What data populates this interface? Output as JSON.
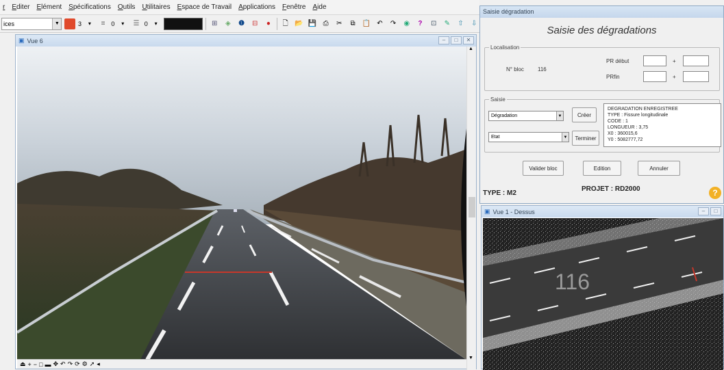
{
  "menu": {
    "items": [
      "r",
      "Editer",
      "Elément",
      "Spécifications",
      "Outils",
      "Utilitaires",
      "Espace de Travail",
      "Applications",
      "Fenêtre",
      "Aide"
    ]
  },
  "toolbar": {
    "combo_value": "ices",
    "spin1": "3",
    "spin2": "0",
    "spin3": "0"
  },
  "vue6": {
    "title": "Vue 6"
  },
  "dialog": {
    "window_title": "Saisie dégradation",
    "heading": "Saisie des dégradations",
    "localisation": {
      "legend": "Localisation",
      "bloc_label": "N° bloc",
      "bloc_value": "116",
      "pr_debut_label": "PR début",
      "pr_fin_label": "PRfin",
      "plus": "+"
    },
    "saisie": {
      "legend": "Saisie",
      "select1": "Dégradation",
      "select2": "Etat",
      "creer_button": "Créer",
      "terminer_button": "Terminer",
      "info_lines": [
        "DEGRADATION ENREGISTREE",
        "TYPE : Fissure longitudinale",
        "CODE : 1",
        "LONGUEUR : 3,75",
        "X0 : 360015,6",
        "Y0 : 5082777,72"
      ]
    },
    "buttons": {
      "valider": "Valider bloc",
      "edition": "Edition",
      "annuler": "Annuler"
    },
    "type_label": "TYPE : M2",
    "projet_label": "PROJET : RD2000",
    "help": "?"
  },
  "vue1": {
    "title": "Vue 1 - Dessus",
    "bloc_overlay": "116"
  },
  "colors": {
    "window_title_bg": "#c9daee",
    "help_icon": "#f2b126",
    "crack_marker": "#c8372a"
  }
}
